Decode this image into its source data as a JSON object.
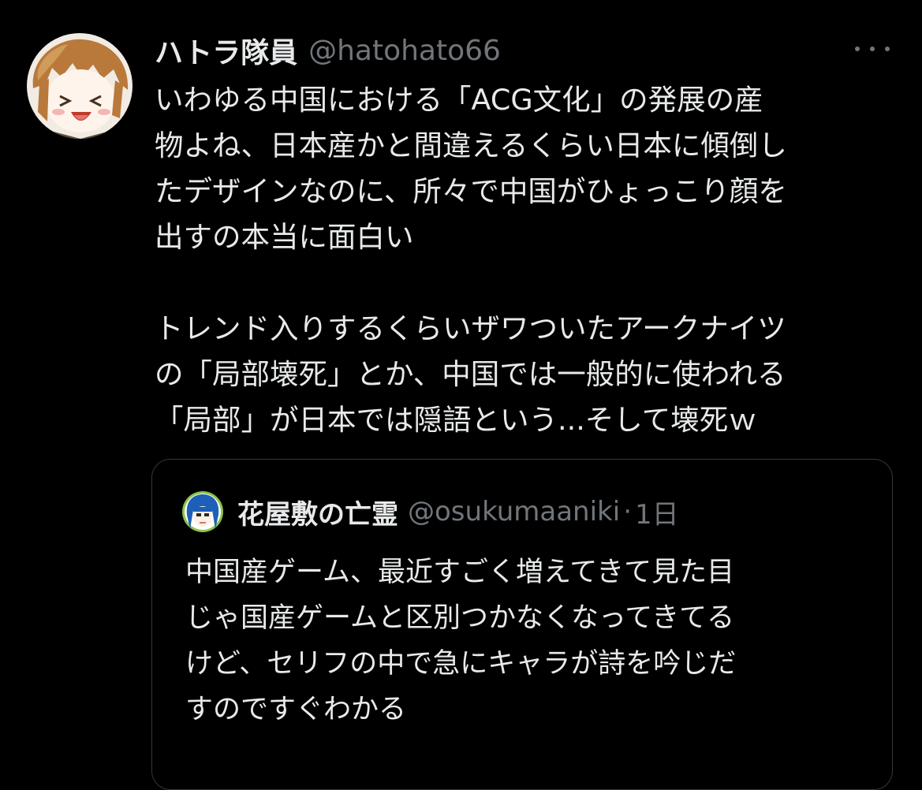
{
  "tweet": {
    "display_name": "ハトラ隊員",
    "handle": "@hatohato66",
    "more_icon": "more-horizontal-icon",
    "paragraphs": [
      [
        "いわゆる中国における「ACG文化」の発展の産",
        "物よね、日本産かと間違えるくらい日本に傾倒し",
        "たデザインなのに、所々で中国がひょっこり顔を",
        "出すの本当に面白い"
      ],
      [
        "トレンド入りするくらいザワついたアークナイツ",
        "の「局部壊死」とか、中国では一般的に使われる",
        "「局部」が日本では隠語という...そして壊死ｗ"
      ]
    ]
  },
  "quoted_tweet": {
    "display_name": "花屋敷の亡霊",
    "handle": "@osukumaaniki",
    "separator": "·",
    "timestamp": "1日",
    "lines": [
      "中国産ゲーム、最近すごく増えてきて見た目",
      "じゃ国産ゲームと区別つかなくなってきてる",
      "けど、セリフの中で急にキャラが詩を吟じだ",
      "すのですぐわかる"
    ]
  },
  "colors": {
    "background": "#000000",
    "text_primary": "#e7e9ea",
    "text_secondary": "#71767b",
    "border": "#333639"
  }
}
